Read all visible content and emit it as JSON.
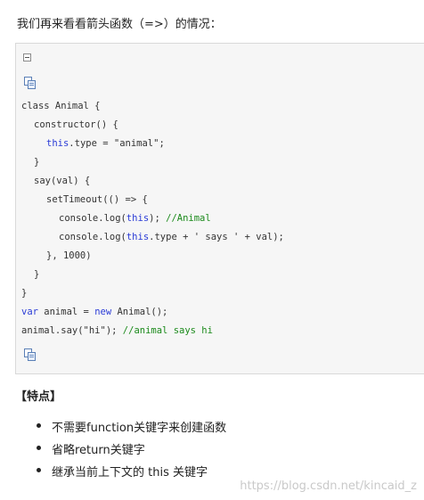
{
  "intro": "我们再来看看箭头函数（=>）的情况：",
  "code_box": {
    "collapse_icon": "collapse-minus-icon",
    "copy_icon": "copy-code-icon",
    "lines": [
      {
        "indent": "",
        "parts": [
          {
            "t": "class Animal {",
            "c": "plain"
          }
        ]
      },
      {
        "indent": "  ",
        "parts": [
          {
            "t": "constructor() {",
            "c": "plain"
          }
        ]
      },
      {
        "indent": "    ",
        "parts": [
          {
            "t": "this",
            "c": "kw"
          },
          {
            "t": ".type = \"animal\";",
            "c": "plain"
          }
        ]
      },
      {
        "indent": "  ",
        "parts": [
          {
            "t": "}",
            "c": "plain"
          }
        ]
      },
      {
        "indent": "  ",
        "parts": [
          {
            "t": "say(val) {",
            "c": "plain"
          }
        ]
      },
      {
        "indent": "    ",
        "parts": [
          {
            "t": "setTimeout(() => {",
            "c": "plain"
          }
        ]
      },
      {
        "indent": "      ",
        "parts": [
          {
            "t": "console.log(",
            "c": "plain"
          },
          {
            "t": "this",
            "c": "kw"
          },
          {
            "t": "); ",
            "c": "plain"
          },
          {
            "t": "//Animal",
            "c": "cm"
          }
        ]
      },
      {
        "indent": "      ",
        "parts": [
          {
            "t": "console.log(",
            "c": "plain"
          },
          {
            "t": "this",
            "c": "kw"
          },
          {
            "t": ".type + ' says ' + val);",
            "c": "plain"
          }
        ]
      },
      {
        "indent": "    ",
        "parts": [
          {
            "t": "}, 1000)",
            "c": "plain"
          }
        ]
      },
      {
        "indent": "  ",
        "parts": [
          {
            "t": "}",
            "c": "plain"
          }
        ]
      },
      {
        "indent": "",
        "parts": [
          {
            "t": "}",
            "c": "plain"
          }
        ]
      },
      {
        "indent": "",
        "parts": [
          {
            "t": "var",
            "c": "kw"
          },
          {
            "t": " animal = ",
            "c": "plain"
          },
          {
            "t": "new",
            "c": "kw"
          },
          {
            "t": " Animal();",
            "c": "plain"
          }
        ]
      },
      {
        "indent": "",
        "parts": [
          {
            "t": "animal.say(\"hi\"); ",
            "c": "plain"
          },
          {
            "t": "//animal says hi",
            "c": "cm"
          }
        ]
      }
    ]
  },
  "features": {
    "title": "【特点】",
    "items": [
      "不需要function关键字来创建函数",
      "省略return关键字",
      "继承当前上下文的 this 关键字"
    ]
  },
  "watermark": "https://blog.csdn.net/kincaid_z",
  "colors": {
    "keyword": "#2a3bd6",
    "comment": "#1b8a1b",
    "code_background": "#f6f6f6"
  }
}
